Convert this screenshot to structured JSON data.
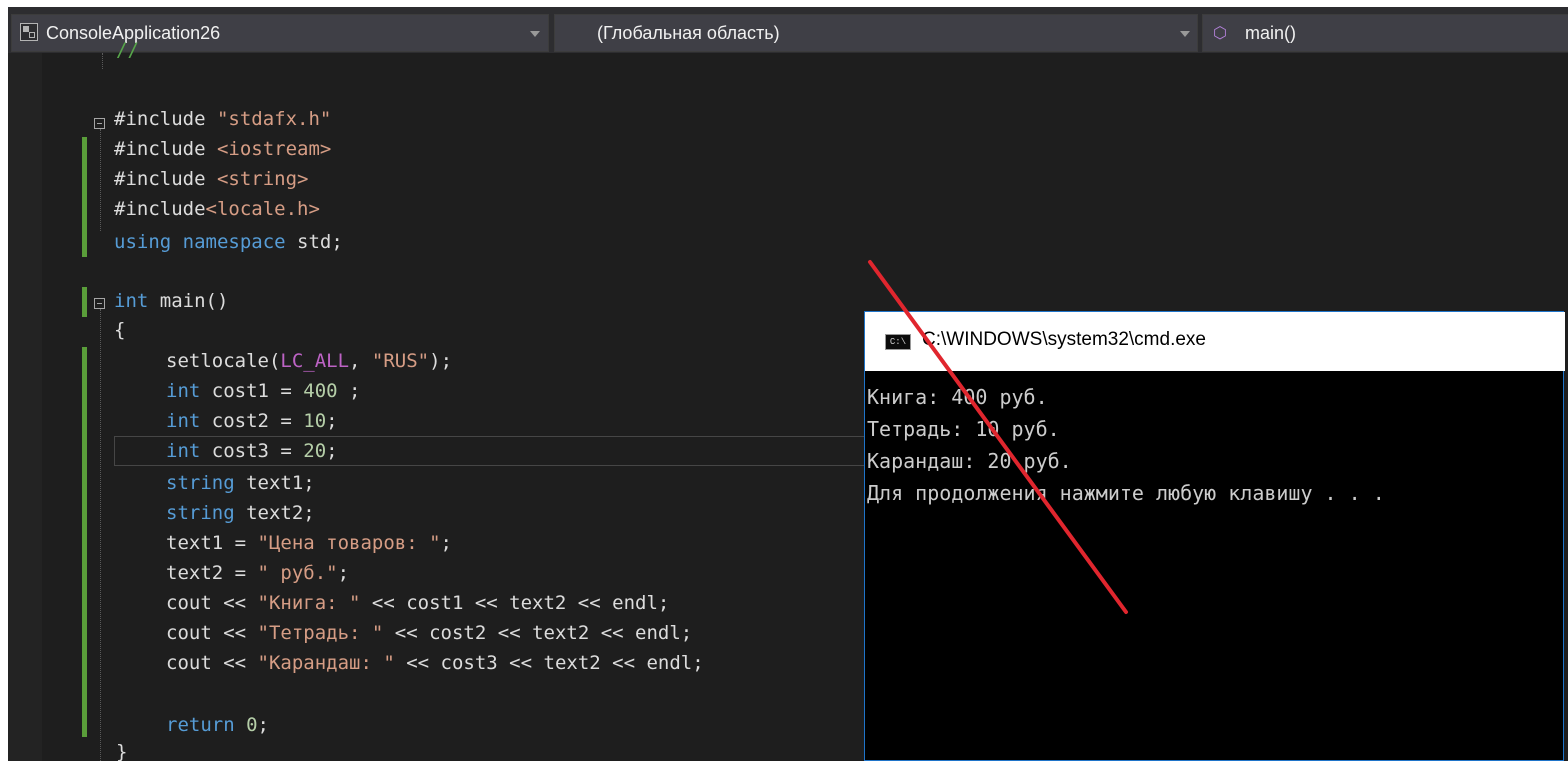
{
  "navbar": {
    "project": "ConsoleApplication26",
    "scope": "(Глобальная область)",
    "member": "main()",
    "project_icon": "project-icon",
    "member_icon": "method-cube-icon"
  },
  "code": {
    "partial_top": "//",
    "include1_kw": "#include",
    "include1_val": "\"stdafx.h\"",
    "include2_kw": "#include",
    "include2_val": "<iostream>",
    "include3_kw": "#include",
    "include3_val": "<string>",
    "include4_kw": "#include",
    "include4_val": "<locale.h>",
    "using_kw": "using namespace",
    "using_rest": " std;",
    "main_kw": "int",
    "main_rest": " main()",
    "open_brace": "{",
    "setlocale_fn": "setlocale(",
    "setlocale_mac": "LC_ALL",
    "setlocale_sep": ", ",
    "setlocale_str": "\"RUS\"",
    "setlocale_end": ");",
    "cost1_kw": "int",
    "cost1_rest": " cost1 = ",
    "cost1_num": "400",
    "cost1_end": " ;",
    "cost2_kw": "int",
    "cost2_rest": " cost2 = ",
    "cost2_num": "10",
    "cost2_end": ";",
    "cost3_kw": "int",
    "cost3_rest": " cost3 = ",
    "cost3_num": "20",
    "cost3_end": ";",
    "text1_decl_kw": "string",
    "text1_decl_rest": " text1;",
    "text2_decl_kw": "string",
    "text2_decl_rest": " text2;",
    "text1_assign_pre": "text1 = ",
    "text1_assign_str": "\"Цена товаров: \"",
    "text1_assign_end": ";",
    "text2_assign_pre": "text2 = ",
    "text2_assign_str": "\" руб.\"",
    "text2_assign_end": ";",
    "cout1_pre": "cout << ",
    "cout1_str": "\"Книга: \"",
    "cout1_rest": " << cost1 << text2 << endl;",
    "cout2_pre": "cout << ",
    "cout2_str": "\"Тетрадь: \"",
    "cout2_rest": " << cost2 << text2 << endl;",
    "cout3_pre": "cout << ",
    "cout3_str": "\"Карандаш: \"",
    "cout3_rest": " << cost3 << text2 << endl;",
    "return_kw": "return",
    "return_sp": " ",
    "return_num": "0",
    "return_end": ";",
    "close_brace": "}"
  },
  "console": {
    "title": "C:\\WINDOWS\\system32\\cmd.exe",
    "icon_label": "C:\\",
    "lines": [
      "Книга: 400 руб.",
      "Тетрадь: 10 руб.",
      "Карандаш: 20 руб.",
      "Для продолжения нажмите любую клавишу . . ."
    ]
  },
  "colors": {
    "editor_bg": "#1e1e1e",
    "keyword": "#569cd6",
    "string": "#d69d85",
    "number": "#b5cea8",
    "macro": "#bd63c5",
    "annotation_line": "#e0262e"
  }
}
